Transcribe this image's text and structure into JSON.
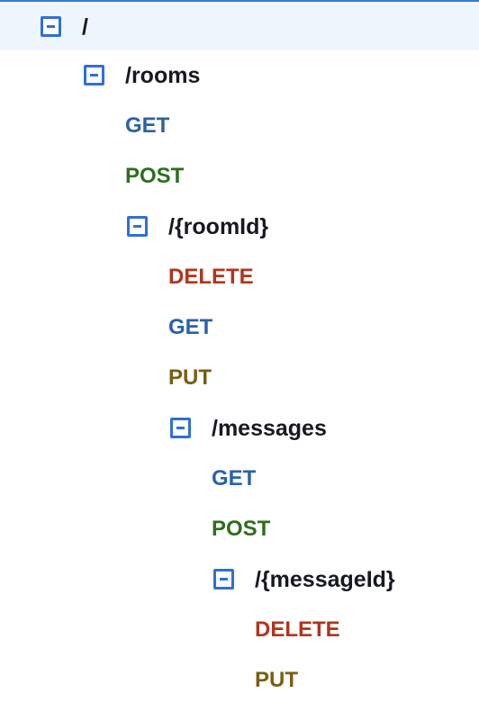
{
  "tree": [
    {
      "type": "resource",
      "label": "/",
      "level": 0,
      "selected": true
    },
    {
      "type": "resource",
      "label": "/rooms",
      "level": 1
    },
    {
      "type": "method",
      "label": "GET",
      "level": 2
    },
    {
      "type": "method",
      "label": "POST",
      "level": 2
    },
    {
      "type": "resource",
      "label": "/{roomId}",
      "level": 2
    },
    {
      "type": "method",
      "label": "DELETE",
      "level": 3
    },
    {
      "type": "method",
      "label": "GET",
      "level": 3
    },
    {
      "type": "method",
      "label": "PUT",
      "level": 3
    },
    {
      "type": "resource",
      "label": "/messages",
      "level": 3
    },
    {
      "type": "method",
      "label": "GET",
      "level": 4
    },
    {
      "type": "method",
      "label": "POST",
      "level": 4
    },
    {
      "type": "resource",
      "label": "/{messageId}",
      "level": 4
    },
    {
      "type": "method",
      "label": "DELETE",
      "level": 5
    },
    {
      "type": "method",
      "label": "PUT",
      "level": 5
    }
  ],
  "colors": {
    "GET": "#2b63a8",
    "POST": "#2f6e1e",
    "DELETE": "#b1361d",
    "PUT": "#7a5d12",
    "toggle": "#2f6fd8",
    "selected_bg": "#eef5fc",
    "selected_border": "#2f7ed6"
  },
  "icons": {
    "toggle": "collapse-icon"
  }
}
